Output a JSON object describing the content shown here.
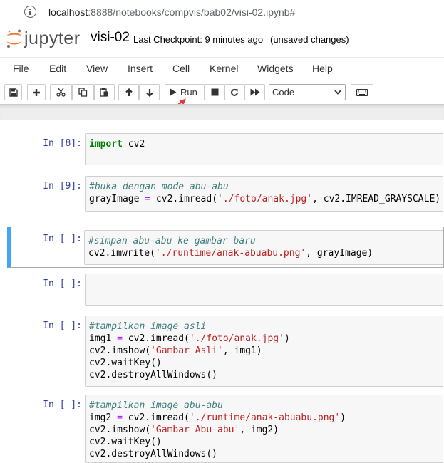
{
  "browser": {
    "host": "localhost",
    "url_rest": ":8888/notebooks/compvis/bab02/visi-02.ipynb#"
  },
  "header": {
    "brand": "jupyter",
    "notebook_name": "visi-02",
    "checkpoint": "Last Checkpoint: 9 minutes ago",
    "status": "(unsaved changes)"
  },
  "menu": [
    "File",
    "Edit",
    "View",
    "Insert",
    "Cell",
    "Kernel",
    "Widgets",
    "Help"
  ],
  "toolbar": {
    "run_label": "Run",
    "cell_type": "Code",
    "icons": [
      "save-icon",
      "plus-icon",
      "cut-icon",
      "copy-icon",
      "paste-icon",
      "arrow-up-icon",
      "arrow-down-icon",
      "play-icon",
      "stop-icon",
      "restart-icon",
      "fast-forward-icon",
      "keyboard-icon"
    ]
  },
  "cells": [
    {
      "prompt": "In [8]:",
      "lines": [
        [
          [
            "kw",
            "import"
          ],
          [
            "",
            "  cv2"
          ]
        ]
      ]
    },
    {
      "prompt": "In [9]:",
      "lines": [
        [
          [
            "cm",
            "#buka dengan mode abu-abu"
          ]
        ],
        [
          [
            "",
            "grayImage "
          ],
          [
            "eq",
            "="
          ],
          [
            "",
            "  cv2.imread("
          ],
          [
            "st",
            "'./foto/anak.jpg'"
          ],
          [
            "",
            ", cv2.IMREAD_GRAYSCALE)"
          ]
        ]
      ]
    },
    {
      "prompt": "In [ ]:",
      "selected": true,
      "lines": [
        [
          [
            "cm",
            "#simpan abu-abu ke gambar baru"
          ]
        ],
        [
          [
            "",
            "cv2.imwrite("
          ],
          [
            "st",
            "'./runtime/anak-abuabu.png'"
          ],
          [
            "",
            ", grayImage)"
          ]
        ]
      ]
    },
    {
      "prompt": "In [ ]:",
      "lines": [
        [
          [
            "",
            ""
          ]
        ]
      ]
    },
    {
      "prompt": "In [ ]:",
      "lines": [
        [
          [
            "cm",
            "#tampilkan image asli"
          ]
        ],
        [
          [
            "",
            "img1 "
          ],
          [
            "eq",
            "="
          ],
          [
            "",
            "  cv2.imread("
          ],
          [
            "st",
            "'./foto/anak.jpg'"
          ],
          [
            "",
            ")"
          ]
        ],
        [
          [
            "",
            "cv2.imshow("
          ],
          [
            "st",
            "'Gambar Asli'"
          ],
          [
            "",
            ", img1)"
          ]
        ],
        [
          [
            "",
            "cv2.waitKey()"
          ]
        ],
        [
          [
            "",
            "cv2.destroyAllWindows()"
          ]
        ]
      ]
    },
    {
      "prompt": "In [ ]:",
      "lines": [
        [
          [
            "cm",
            "#tampilkan image abu-abu"
          ]
        ],
        [
          [
            "",
            "img2 "
          ],
          [
            "eq",
            "="
          ],
          [
            "",
            "  cv2.imread("
          ],
          [
            "st",
            "'./runtime/anak-abuabu.png'"
          ],
          [
            "",
            ")"
          ]
        ],
        [
          [
            "",
            "cv2.imshow("
          ],
          [
            "st",
            "'Gambar Abu-abu'"
          ],
          [
            "",
            ", img2)"
          ]
        ],
        [
          [
            "",
            "cv2.waitKey()"
          ]
        ],
        [
          [
            "",
            "cv2.destroyAllWindows()"
          ]
        ]
      ]
    }
  ]
}
